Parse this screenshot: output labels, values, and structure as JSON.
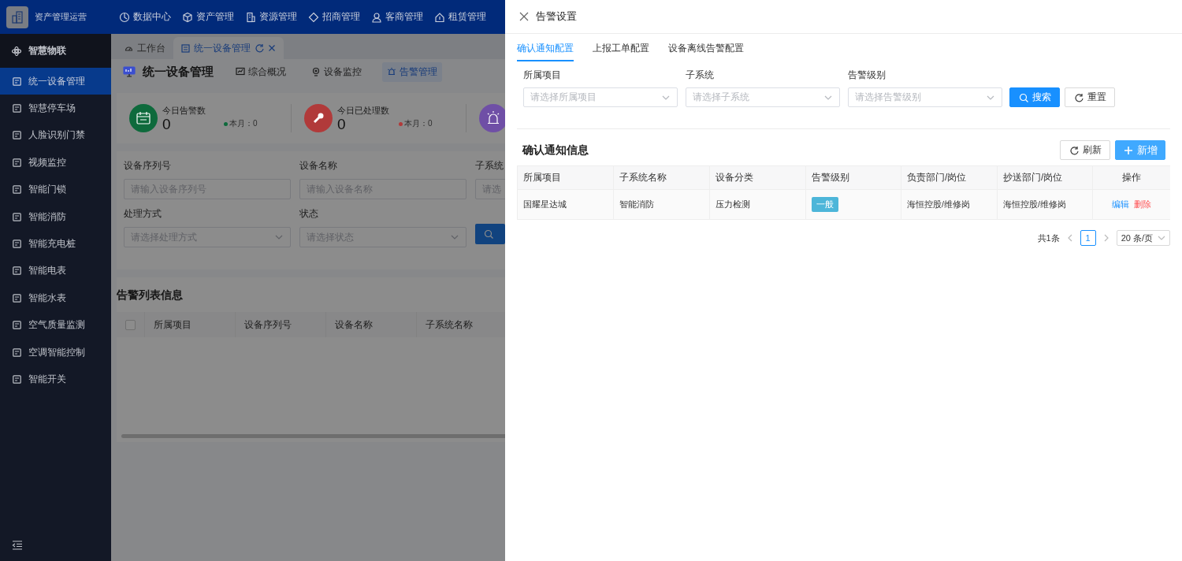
{
  "app": {
    "title": "资产管理运营"
  },
  "top_nav": [
    {
      "label": "数据中心"
    },
    {
      "label": "资产管理"
    },
    {
      "label": "资源管理"
    },
    {
      "label": "招商管理"
    },
    {
      "label": "客商管理"
    },
    {
      "label": "租赁管理"
    }
  ],
  "sidebar": {
    "group": "智慧物联",
    "items": [
      {
        "label": "统一设备管理",
        "selected": true
      },
      {
        "label": "智慧停车场",
        "selected": false
      },
      {
        "label": "人脸识别门禁",
        "selected": false
      },
      {
        "label": "视频监控",
        "selected": false
      },
      {
        "label": "智能门锁",
        "selected": false
      },
      {
        "label": "智能消防",
        "selected": false
      },
      {
        "label": "智能充电桩",
        "selected": false
      },
      {
        "label": "智能电表",
        "selected": false
      },
      {
        "label": "智能水表",
        "selected": false
      },
      {
        "label": "空气质量监测",
        "selected": false
      },
      {
        "label": "空调智能控制",
        "selected": false
      },
      {
        "label": "智能开关",
        "selected": false
      }
    ]
  },
  "page_tabs": [
    {
      "label": "工作台",
      "selected": false
    },
    {
      "label": "统一设备管理",
      "selected": true
    }
  ],
  "page": {
    "title": "统一设备管理",
    "subtabs": [
      {
        "label": "综合概况",
        "selected": false
      },
      {
        "label": "设备监控",
        "selected": false
      },
      {
        "label": "告警管理",
        "selected": true
      }
    ],
    "stats": [
      {
        "label": "今日告警数",
        "value": "0",
        "month": "本月：0",
        "color": "#0e6a3c"
      },
      {
        "label": "今日已处理数",
        "value": "0",
        "month": "本月：0",
        "color": "#b13a3a"
      },
      {
        "color": "#6f4fa6"
      }
    ],
    "filters": [
      {
        "label": "设备序列号",
        "placeholder": "请输入设备序列号",
        "kind": "input"
      },
      {
        "label": "设备名称",
        "placeholder": "请输入设备名称",
        "kind": "input"
      },
      {
        "label": "子系统",
        "placeholder": "请选",
        "kind": "input"
      },
      {
        "label": "处理方式",
        "placeholder": "请选择处理方式",
        "kind": "select"
      },
      {
        "label": "状态",
        "placeholder": "请选择状态",
        "kind": "select"
      },
      {
        "kind": "search"
      }
    ],
    "section_title": "告警列表信息",
    "select_all": {
      "checked": false
    },
    "table_columns": [
      "所属项目",
      "设备序列号",
      "设备名称",
      "子系统名称"
    ]
  },
  "drawer": {
    "title": "告警设置",
    "tabs": [
      {
        "label": "确认通知配置",
        "selected": true
      },
      {
        "label": "上报工单配置",
        "selected": false
      },
      {
        "label": "设备离线告警配置",
        "selected": false
      }
    ],
    "filters": [
      {
        "label": "所属项目",
        "placeholder": "请选择所属项目"
      },
      {
        "label": "子系统",
        "placeholder": "请选择子系统"
      },
      {
        "label": "告警级别",
        "placeholder": "请选择告警级别"
      }
    ],
    "search_button": "搜索",
    "reset_button": "重置",
    "section_title": "确认通知信息",
    "refresh_button": "刷新",
    "add_button": "新增",
    "table": {
      "columns": [
        "所属项目",
        "子系统名称",
        "设备分类",
        "告警级别",
        "负责部门/岗位",
        "抄送部门/岗位",
        "操作"
      ],
      "rows": [
        {
          "project": "国耀星达城",
          "subsystem": "智能消防",
          "category": "压力检测",
          "level": {
            "text": "一般",
            "color": "#4db6d9"
          },
          "owner": "海恒控股/维修岗",
          "cc": "海恒控股/维修岗",
          "actions": [
            {
              "label": "编辑",
              "kind": "primary"
            },
            {
              "label": "删除",
              "kind": "danger"
            }
          ]
        }
      ]
    },
    "pagination": {
      "total": "共1条",
      "pages": [
        {
          "label": "1",
          "selected": true
        }
      ],
      "page_size": "20 条/页"
    }
  }
}
